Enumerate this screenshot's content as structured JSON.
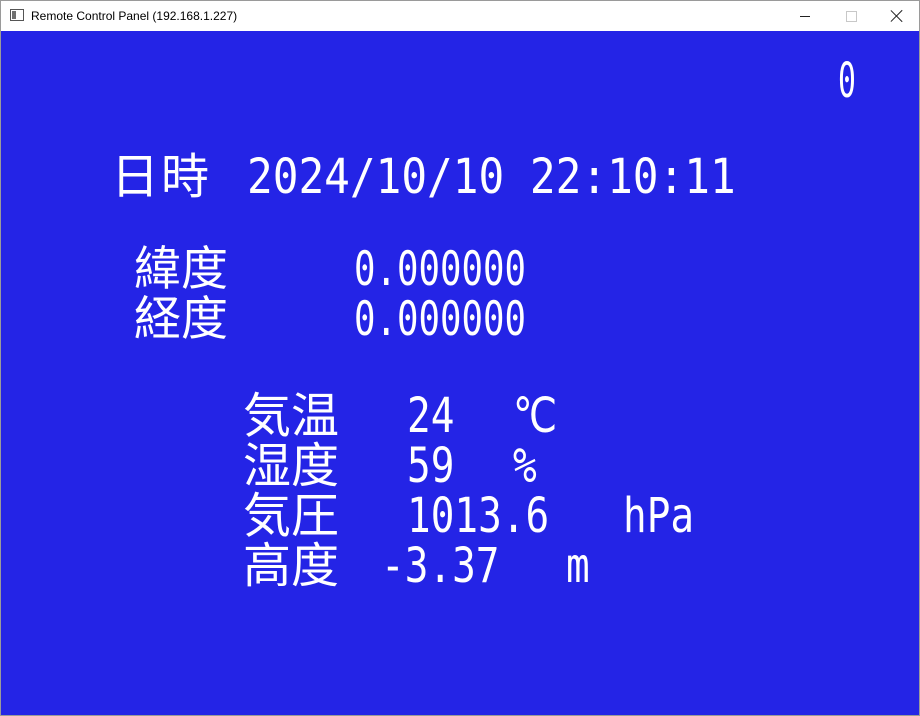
{
  "window": {
    "title": "Remote Control Panel (192.168.1.227)",
    "background_color": "#2424e6",
    "text_color": "#ffffff",
    "icons": {
      "app": "app-window-icon",
      "minimize": "minimize-icon",
      "maximize": "maximize-icon",
      "close": "close-icon"
    }
  },
  "display": {
    "counter": "0",
    "datetime": {
      "label": "日時",
      "value": "2024/10/10 22:10:11"
    },
    "latitude": {
      "label": "緯度",
      "value": "0.000000"
    },
    "longitude": {
      "label": "経度",
      "value": "0.000000"
    },
    "temperature": {
      "label": "気温",
      "value": "24",
      "unit": "℃"
    },
    "humidity": {
      "label": "湿度",
      "value": "59",
      "unit": "%"
    },
    "pressure": {
      "label": "気圧",
      "value": "1013.6",
      "unit": "hPa"
    },
    "altitude": {
      "label": "高度",
      "value": "-3.37",
      "unit": "m"
    }
  }
}
